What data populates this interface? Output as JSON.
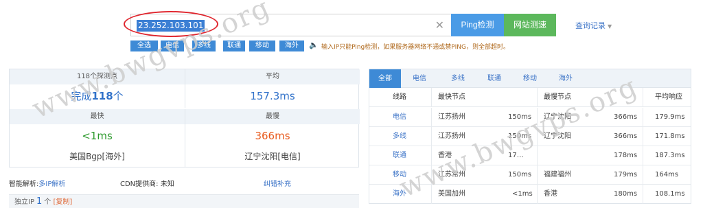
{
  "search": {
    "value": "23.252.103.101",
    "clear_icon": "close-icon"
  },
  "buttons": {
    "ping": "Ping检测",
    "speed": "网站测速"
  },
  "history": {
    "label": "查询记录",
    "caret": "▼"
  },
  "chips": [
    "全选",
    "电信",
    "多线",
    "联通",
    "移动",
    "海外"
  ],
  "hint": {
    "icon": "speaker-icon",
    "text": "输入IP只能Ping检测，如果服务器网络不通或禁PING，则全部超时。"
  },
  "summary": {
    "points_head": "118个探测点",
    "avg_head": "平均",
    "done_prefix": "完成",
    "done_count": "118",
    "done_suffix": "个",
    "avg_value": "157.3ms",
    "fastest_head": "最快",
    "slowest_head": "最慢",
    "fastest_value": "<1ms",
    "slowest_value": "366ms",
    "fastest_loc": "美国Bgp[海外]",
    "slowest_loc": "辽宁沈阳[电信]"
  },
  "dns": {
    "label": "智能解析:",
    "link": "多IP解析",
    "cdn": "CDN提供商: 未知",
    "fix": "纠错补充"
  },
  "ipbar": {
    "label": "独立IP",
    "count": "1",
    "unit": "个",
    "copy": "[复制]"
  },
  "tabs": [
    "全部",
    "电信",
    "多线",
    "联通",
    "移动",
    "海外"
  ],
  "table": {
    "headers": [
      "线路",
      "最快节点",
      "最慢节点",
      "平均响应"
    ],
    "rows": [
      {
        "line": "电信",
        "fast_node": "江苏扬州",
        "fast_ms": "150ms",
        "slow_node": "辽宁沈阳",
        "slow_ms": "366ms",
        "avg": "179.9ms"
      },
      {
        "line": "多线",
        "fast_node": "江苏扬州",
        "fast_ms": "150ms",
        "slow_node": "辽宁沈阳",
        "slow_ms": "366ms",
        "avg": "171.8ms"
      },
      {
        "line": "联通",
        "fast_node": "香港",
        "fast_ms": "17…",
        "slow_node": "",
        "slow_ms": "178ms",
        "avg": "187.3ms"
      },
      {
        "line": "移动",
        "fast_node": "江苏常州",
        "fast_ms": "150ms",
        "slow_node": "福建福州",
        "slow_ms": "179ms",
        "avg": "164ms"
      },
      {
        "line": "海外",
        "fast_node": "美国加州",
        "fast_ms": "<1ms",
        "slow_node": "香港",
        "slow_ms": "180ms",
        "avg": "108.1ms"
      }
    ]
  },
  "watermarks": {
    "text": "www.bwgvps.org"
  },
  "colors": {
    "accent": "#3e8ad6",
    "ping": "#4a9be6",
    "speed": "#5cb85c",
    "highlight": "#e0262e",
    "fast": "#2e9a2e",
    "slow": "#e85a1d"
  }
}
